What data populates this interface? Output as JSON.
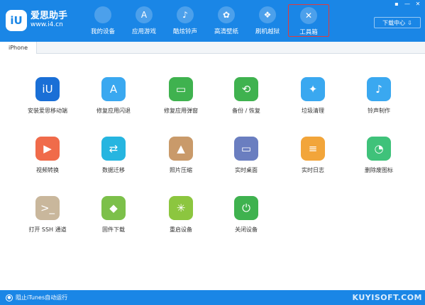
{
  "app": {
    "logo_mark": "iU",
    "name": "爱思助手",
    "url": "www.i4.cn"
  },
  "nav": [
    {
      "label": "我的设备",
      "icon": "apple-icon",
      "glyph": ""
    },
    {
      "label": "应用游戏",
      "icon": "app-store-icon",
      "glyph": "A"
    },
    {
      "label": "酷炫铃声",
      "icon": "bell-icon",
      "glyph": "♪"
    },
    {
      "label": "高清壁纸",
      "icon": "flower-icon",
      "glyph": "✿"
    },
    {
      "label": "刷机越狱",
      "icon": "dropbox-icon",
      "glyph": "❖"
    },
    {
      "label": "工具箱",
      "icon": "wrench-icon",
      "glyph": "✕"
    }
  ],
  "active_nav": 5,
  "window_controls": [
    "▪",
    "—",
    "✕"
  ],
  "download_center": {
    "label": "下载中心",
    "icon": "download-icon",
    "glyph": "⇩"
  },
  "tabs": [
    {
      "label": "iPhone"
    }
  ],
  "tools": [
    {
      "label": "安装爱思移动端",
      "icon": "i4-app-icon",
      "glyph": "iU",
      "color": "#1a6fd6"
    },
    {
      "label": "修复应用闪退",
      "icon": "app-store-icon",
      "glyph": "A",
      "color": "#3aa8f0"
    },
    {
      "label": "修复应用弹窗",
      "icon": "apple-id-icon",
      "glyph": "▭",
      "color": "#3fb24f"
    },
    {
      "label": "备份 / 恢复",
      "icon": "restore-clock-icon",
      "glyph": "⟲",
      "color": "#3fb24f"
    },
    {
      "label": "垃圾清理",
      "icon": "broom-icon",
      "glyph": "✦",
      "color": "#3aa8f0"
    },
    {
      "label": "铃声制作",
      "icon": "bell-plus-icon",
      "glyph": "♪",
      "color": "#3aa8f0"
    },
    {
      "label": "视频转换",
      "icon": "video-play-icon",
      "glyph": "▶",
      "color": "#f06b4a"
    },
    {
      "label": "数据迁移",
      "icon": "data-transfer-icon",
      "glyph": "⇄",
      "color": "#26b5e0"
    },
    {
      "label": "照片压缩",
      "icon": "photo-icon",
      "glyph": "▲",
      "color": "#c99a6a"
    },
    {
      "label": "实时桌面",
      "icon": "monitor-icon",
      "glyph": "▭",
      "color": "#6a7ec0"
    },
    {
      "label": "实时日志",
      "icon": "log-document-icon",
      "glyph": "≡",
      "color": "#f2a53a"
    },
    {
      "label": "删除废图标",
      "icon": "pie-icon",
      "glyph": "◔",
      "color": "#3fc27a"
    },
    {
      "label": "打开 SSH 通道",
      "icon": "terminal-icon",
      "glyph": ">_",
      "color": "#c9b79c"
    },
    {
      "label": "固件下载",
      "icon": "cube-icon",
      "glyph": "◆",
      "color": "#7cc04a"
    },
    {
      "label": "重启设备",
      "icon": "restart-spark-icon",
      "glyph": "✳",
      "color": "#8cc63f"
    },
    {
      "label": "关闭设备",
      "icon": "power-icon",
      "glyph": "⏻",
      "color": "#3fb24f"
    }
  ],
  "status": {
    "itunes_label": "阻止iTunes自动运行"
  },
  "watermark": "KUYISOFT.COM"
}
